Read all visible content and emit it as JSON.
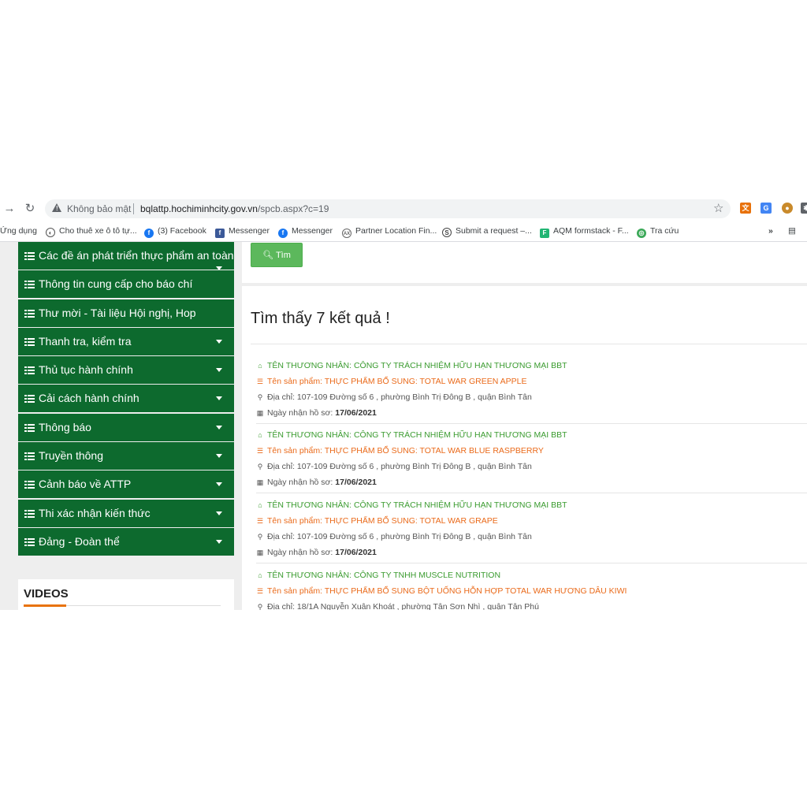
{
  "browser": {
    "security_label": "Không bảo mật",
    "url_host": "bqlattp.hochiminhcity.gov.vn",
    "url_path": "/spcb.aspx?c=19"
  },
  "bookmarks": [
    {
      "label": "Ứng dụng",
      "icon": "apps-icon"
    },
    {
      "label": "Cho thuê xe ô tô tự...",
      "icon": "globe-icon"
    },
    {
      "label": "(3) Facebook",
      "icon": "facebook-icon"
    },
    {
      "label": "Messenger",
      "icon": "facebook-square-icon"
    },
    {
      "label": "Messenger",
      "icon": "facebook-icon"
    },
    {
      "label": "Partner Location Fin...",
      "icon": "location-icon"
    },
    {
      "label": "Submit a request –...",
      "icon": "s-icon"
    },
    {
      "label": "AQM formstack - F...",
      "icon": "formstack-icon"
    },
    {
      "label": "Tra cứu",
      "icon": "tra-cuu-icon"
    }
  ],
  "sidebar": {
    "items": [
      {
        "label": "Các đề án phát triển thực phẩm an toàn",
        "has_caret": true
      },
      {
        "label": "Thông tin cung cấp cho báo chí",
        "has_caret": false
      },
      {
        "label": "Thư mời - Tài liệu Hội nghị, Hop",
        "has_caret": false
      },
      {
        "label": "Thanh tra, kiểm tra",
        "has_caret": true
      },
      {
        "label": "Thủ tục hành chính",
        "has_caret": true
      },
      {
        "label": "Cải cách hành chính",
        "has_caret": true
      },
      {
        "label": "Thông báo",
        "has_caret": true
      },
      {
        "label": "Truyền thông",
        "has_caret": true
      },
      {
        "label": "Cảnh báo về ATTP",
        "has_caret": true
      },
      {
        "label": "Thi xác nhận kiến thức",
        "has_caret": true
      },
      {
        "label": "Đảng - Đoàn thể",
        "has_caret": true
      }
    ],
    "videos_title": "VIDEOS"
  },
  "search": {
    "button_label": "Tìm",
    "result_count": "Tìm thấy 7 kết quả !"
  },
  "results": [
    {
      "merchant": "TÊN THƯƠNG NHÂN: CÔNG TY TRÁCH NHIỆM HỮU HẠN THƯƠNG MẠI BBT",
      "product": "Tên sản phẩm: THỰC PHẨM BỔ SUNG: TOTAL WAR GREEN APPLE",
      "address": "Địa chỉ: 107-109 Đường số 6 , phường Bình Trị Đông B , quận Bình Tân",
      "date_label": "Ngày nhận hồ sơ:",
      "date": "17/06/2021"
    },
    {
      "merchant": "TÊN THƯƠNG NHÂN: CÔNG TY TRÁCH NHIỆM HỮU HẠN THƯƠNG MẠI BBT",
      "product": "Tên sản phẩm: THỰC PHẨM BỔ SUNG: TOTAL WAR BLUE RASPBERRY",
      "address": "Địa chỉ: 107-109 Đường số 6 , phường Bình Trị Đông B , quận Bình Tân",
      "date_label": "Ngày nhận hồ sơ:",
      "date": "17/06/2021"
    },
    {
      "merchant": "TÊN THƯƠNG NHÂN: CÔNG TY TRÁCH NHIỆM HỮU HẠN THƯƠNG MẠI BBT",
      "product": "Tên sản phẩm: THỰC PHẨM BỔ SUNG: TOTAL WAR GRAPE",
      "address": "Địa chỉ: 107-109 Đường số 6 , phường Bình Trị Đông B , quận Bình Tân",
      "date_label": "Ngày nhận hồ sơ:",
      "date": "17/06/2021"
    },
    {
      "merchant": "TÊN THƯƠNG NHÂN: CÔNG TY TNHH MUSCLE NUTRITION",
      "product": "Tên sản phẩm: THỰC PHẨM BỔ SUNG BỘT UỐNG HỖN HỢP TOTAL WAR HƯƠNG DÂU KIWI",
      "address": "Địa chỉ: 18/1A Nguyễn Xuân Khoát , phường Tân Sơn Nhì , quận Tân Phú"
    }
  ]
}
